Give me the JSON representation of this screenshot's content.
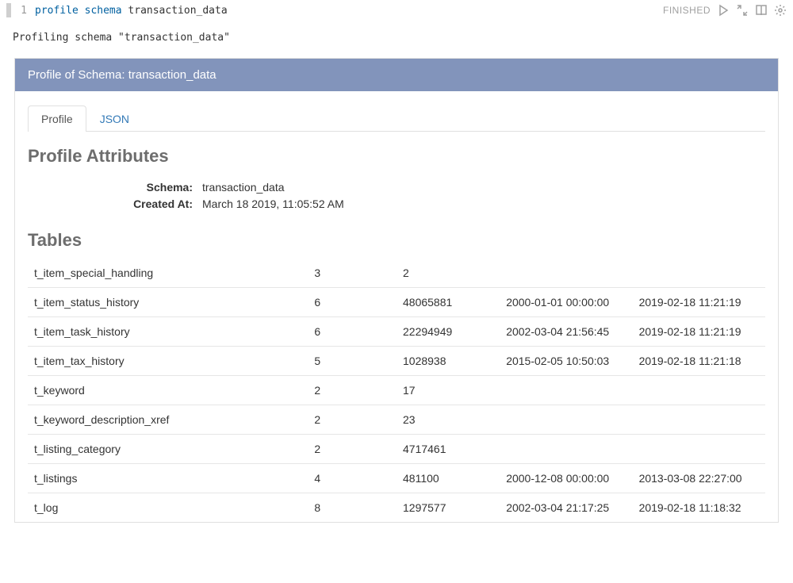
{
  "code": {
    "line_number": "1",
    "token1": "profile",
    "token2": "schema",
    "token3": "transaction_data"
  },
  "toolbar": {
    "status": "FINISHED"
  },
  "output": {
    "message": "Profiling schema \"transaction_data\""
  },
  "panel": {
    "title": "Profile of Schema: transaction_data"
  },
  "tabs": {
    "profile": "Profile",
    "json": "JSON"
  },
  "section": {
    "profile_attributes": "Profile Attributes",
    "tables": "Tables"
  },
  "attributes": {
    "schema_label": "Schema:",
    "schema_value": "transaction_data",
    "created_label": "Created At:",
    "created_value": "March 18 2019, 11:05:52 AM"
  },
  "tables": {
    "rows": [
      {
        "name": "t_item_special_handling",
        "c1": "3",
        "c2": "2",
        "c3": "",
        "c4": ""
      },
      {
        "name": "t_item_status_history",
        "c1": "6",
        "c2": "48065881",
        "c3": "2000-01-01 00:00:00",
        "c4": "2019-02-18 11:21:19"
      },
      {
        "name": "t_item_task_history",
        "c1": "6",
        "c2": "22294949",
        "c3": "2002-03-04 21:56:45",
        "c4": "2019-02-18 11:21:19"
      },
      {
        "name": "t_item_tax_history",
        "c1": "5",
        "c2": "1028938",
        "c3": "2015-02-05 10:50:03",
        "c4": "2019-02-18 11:21:18"
      },
      {
        "name": "t_keyword",
        "c1": "2",
        "c2": "17",
        "c3": "",
        "c4": ""
      },
      {
        "name": "t_keyword_description_xref",
        "c1": "2",
        "c2": "23",
        "c3": "",
        "c4": ""
      },
      {
        "name": "t_listing_category",
        "c1": "2",
        "c2": "4717461",
        "c3": "",
        "c4": ""
      },
      {
        "name": "t_listings",
        "c1": "4",
        "c2": "481100",
        "c3": "2000-12-08 00:00:00",
        "c4": "2013-03-08 22:27:00"
      },
      {
        "name": "t_log",
        "c1": "8",
        "c2": "1297577",
        "c3": "2002-03-04 21:17:25",
        "c4": "2019-02-18 11:18:32"
      }
    ]
  }
}
